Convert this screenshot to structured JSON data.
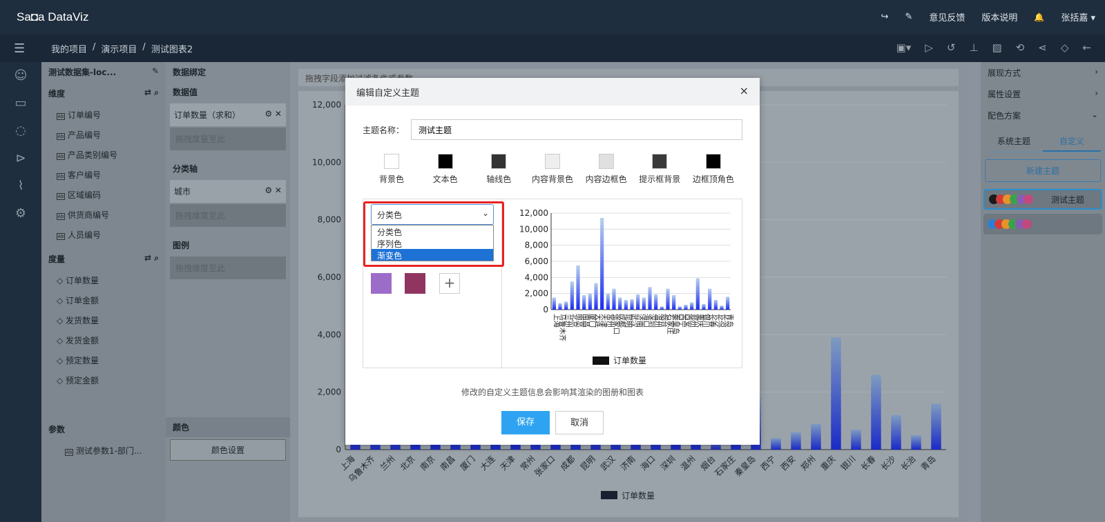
{
  "app": {
    "logo": "Sa◘a DataViz",
    "share_icon": "↪",
    "edit_icon": "✎",
    "feedback": "意见反馈",
    "version": "版本说明",
    "bell_icon": "🔔",
    "user": "张括嘉 ▾"
  },
  "breadcrumb": {
    "items": [
      "我的项目",
      "/",
      "演示项目",
      "/",
      "测试图表2"
    ]
  },
  "toolbar_icons": [
    "save-icon",
    "play-icon",
    "history-icon",
    "stamp-icon",
    "image-icon",
    "undo-icon",
    "share-icon",
    "tag-icon",
    "back-icon"
  ],
  "dataset": {
    "name": "测试数据集-loc...",
    "dimension_label": "维度",
    "dimensions": [
      "订单编号",
      "产品编号",
      "产品类别编号",
      "客户编号",
      "区域编码",
      "供货商编号",
      "人员编号"
    ],
    "measure_label": "度量",
    "measures": [
      "订单数量",
      "订单金额",
      "发货数量",
      "发货金额",
      "预定数量",
      "预定金额"
    ],
    "param_label": "参数",
    "params": [
      "测试参数1-部门..."
    ]
  },
  "binding": {
    "title": "数据绑定",
    "value_label": "数据值",
    "value_pill": "订单数量（求和）",
    "value_drop": "拖拽度量至此",
    "axis_label": "分类轴",
    "axis_pill": "城市",
    "axis_drop": "拖拽维度至此",
    "legend_label": "图例",
    "legend_drop": "拖拽维度至此",
    "color_label": "颜色",
    "color_btn": "颜色设置"
  },
  "canvas": {
    "filter_hint": "拖拽字段添加过滤条件或参数",
    "legend": "订单数量"
  },
  "chart_data": {
    "type": "bar",
    "categories": [
      "上海",
      "乌鲁木齐",
      "兰州",
      "北京",
      "南京",
      "南昌",
      "厦门",
      "大连",
      "天津",
      "常州",
      "张家口",
      "成都",
      "昆明",
      "武汉",
      "济南",
      "海口",
      "深圳",
      "温州",
      "烟台",
      "石家庄",
      "秦皇岛",
      "西宁",
      "西安",
      "郑州",
      "重庆",
      "银川",
      "长春",
      "长沙",
      "长治",
      "青岛"
    ],
    "values": [
      1500,
      800,
      1000,
      3500,
      5500,
      1800,
      2000,
      3300,
      11400,
      2000,
      2600,
      1500,
      1200,
      1300,
      1900,
      1500,
      2800,
      1900,
      400,
      2600,
      1800,
      400,
      600,
      900,
      3900,
      700,
      2600,
      1200,
      500,
      1600
    ],
    "ylim": [
      0,
      12000
    ],
    "yticks": [
      "12,000",
      "10,000",
      "8,000",
      "6,000",
      "4,000",
      "2,000",
      "0"
    ],
    "series": [
      {
        "name": "订单数量",
        "values": [
          1500,
          800,
          1000,
          3500,
          5500,
          1800,
          2000,
          3300,
          11400,
          2000,
          2600,
          1500,
          1200,
          1300,
          1900,
          1500,
          2800,
          1900,
          400,
          2600,
          1800,
          400,
          600,
          900,
          3900,
          700,
          2600,
          1200,
          500,
          1600
        ]
      }
    ]
  },
  "right_panel": {
    "display": "展现方式",
    "props": "属性设置",
    "palette": "配色方案",
    "tab_system": "系统主题",
    "tab_custom": "自定义",
    "new_theme": "新建主题",
    "theme_name": "测试主题",
    "theme_colors": [
      "#1b1b1b",
      "#d33b3b",
      "#e5932a",
      "#3aa34a",
      "#8a5bb5",
      "#c04a7e"
    ],
    "theme2_colors": [
      "#2a7fd4",
      "#d33b3b",
      "#e5932a",
      "#3aa34a",
      "#8a5bb5",
      "#c04a7e"
    ]
  },
  "modal": {
    "title": "编辑自定义主题",
    "close": "×",
    "name_label": "主题名称：",
    "name_value": "测试主题",
    "swatches": [
      {
        "label": "背景色",
        "color": "#ffffff"
      },
      {
        "label": "文本色",
        "color": "#000000"
      },
      {
        "label": "轴线色",
        "color": "#333333"
      },
      {
        "label": "内容背景色",
        "color": "#eeeeee"
      },
      {
        "label": "内容边框色",
        "color": "#e0e0e0"
      },
      {
        "label": "提示框背景",
        "color": "#3a3a3a"
      },
      {
        "label": "边框顶角色",
        "color": "#000000"
      }
    ],
    "select_value": "分类色",
    "options": [
      "分类色",
      "序列色",
      "渐变色"
    ],
    "selected_option": "渐变色",
    "colors": [
      "#9c6cc9",
      "#8f3560"
    ],
    "add": "+",
    "note": "修改的自定义主题信息会影响其渲染的图册和图表",
    "save": "保存",
    "cancel": "取消",
    "mini_legend": "订单数量"
  }
}
